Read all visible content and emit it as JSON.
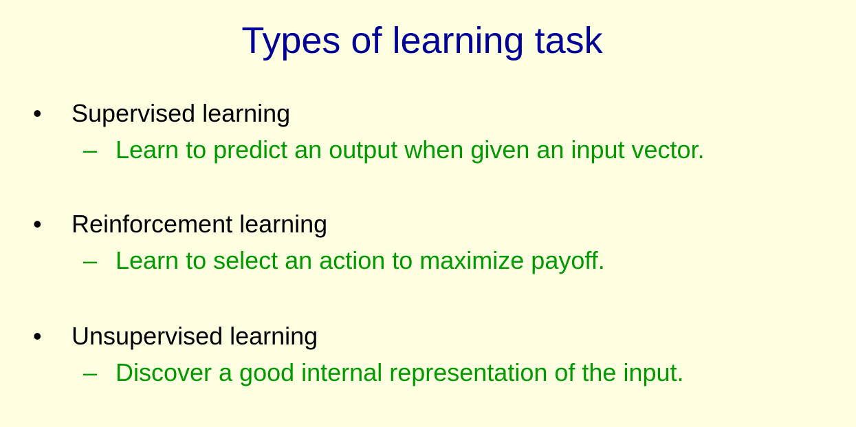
{
  "slide": {
    "title": "Types of learning task",
    "bullets": [
      {
        "marker": "•",
        "text": "Supervised learning",
        "sub_marker": "–",
        "sub_text": "Learn to predict an output when given an input vector."
      },
      {
        "marker": "•",
        "text": "Reinforcement learning",
        "sub_marker": "–",
        "sub_text": "Learn to select an action to maximize payoff."
      },
      {
        "marker": "•",
        "text": "Unsupervised learning",
        "sub_marker": "–",
        "sub_text": "Discover a good internal representation of the input."
      }
    ]
  },
  "colors": {
    "background": "#fefee0",
    "title": "#000099",
    "bullet_text": "#000000",
    "sub_text": "#009900"
  }
}
